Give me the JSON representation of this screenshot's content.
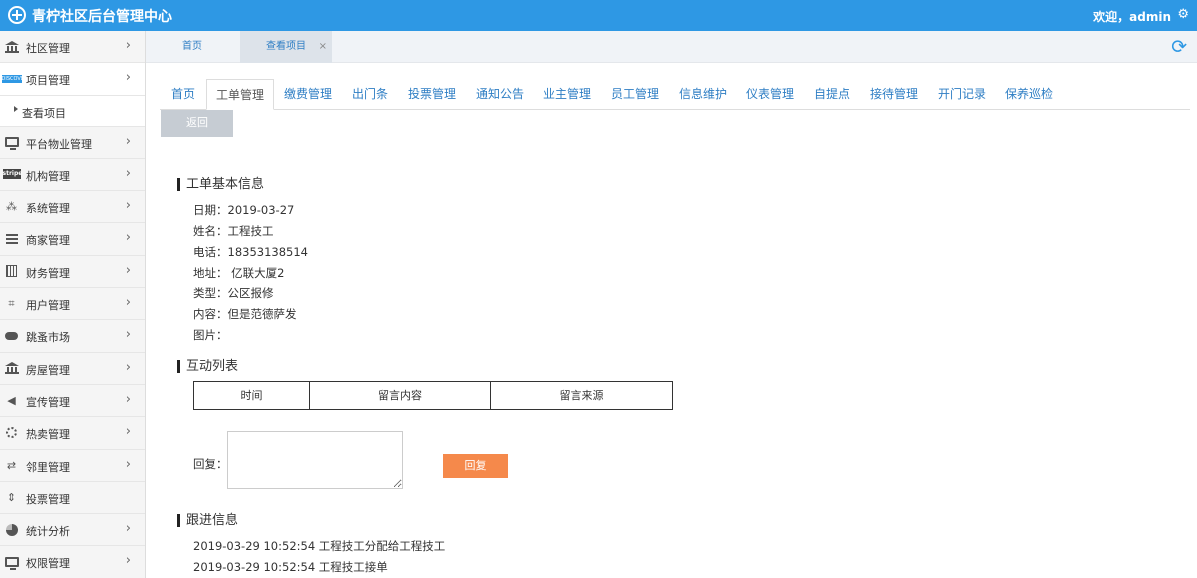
{
  "header": {
    "title": "青柠社区后台管理中心",
    "welcome": "欢迎，admin"
  },
  "sidebar": {
    "items": [
      {
        "label": "社区管理",
        "icon": "bank-icon"
      },
      {
        "label": "项目管理",
        "icon": "discover-icon"
      },
      {
        "label": "查看项目",
        "icon": "caret-right-icon"
      },
      {
        "label": "平台物业管理",
        "icon": "monitor-icon"
      },
      {
        "label": "机构管理",
        "icon": "stripe-icon"
      },
      {
        "label": "系统管理",
        "icon": "cluster-icon"
      },
      {
        "label": "商家管理",
        "icon": "bars-icon"
      },
      {
        "label": "财务管理",
        "icon": "calculator-icon"
      },
      {
        "label": "用户管理",
        "icon": "crop-icon"
      },
      {
        "label": "跳蚤市场",
        "icon": "cloud-icon"
      },
      {
        "label": "房屋管理",
        "icon": "bank-icon"
      },
      {
        "label": "宣传管理",
        "icon": "speaker-icon"
      },
      {
        "label": "热卖管理",
        "icon": "sun-icon"
      },
      {
        "label": "邻里管理",
        "icon": "exchange-icon"
      },
      {
        "label": "投票管理",
        "icon": "sort-icon"
      },
      {
        "label": "统计分析",
        "icon": "pie-chart-icon"
      },
      {
        "label": "权限管理",
        "icon": "monitor-icon"
      }
    ]
  },
  "tabs": {
    "home": "首页",
    "view_project": "查看项目",
    "close": "×"
  },
  "subtabs": [
    "首页",
    "工单管理",
    "缴费管理",
    "出门条",
    "投票管理",
    "通知公告",
    "业主管理",
    "员工管理",
    "信息维护",
    "仪表管理",
    "自提点",
    "接待管理",
    "开门记录",
    "保养巡检"
  ],
  "back_label": "返回",
  "ticket": {
    "section_title": "工单基本信息",
    "date": "日期：2019-03-27",
    "name": "姓名：工程技工",
    "phone": "电话：18353138514",
    "address": "地址： 亿联大厦2",
    "type": "类型：公区报修",
    "content": "内容：但是范德萨发",
    "image": "图片："
  },
  "interaction": {
    "section_title": "互动列表",
    "columns": [
      "时间",
      "留言内容",
      "留言来源"
    ]
  },
  "reply": {
    "label": "回复：",
    "button": "回复"
  },
  "followup": {
    "section_title": "跟进信息",
    "entries": [
      "2019-03-29 10:52:54 工程技工分配给工程技工",
      "2019-03-29 10:52:54 工程技工接单"
    ]
  }
}
